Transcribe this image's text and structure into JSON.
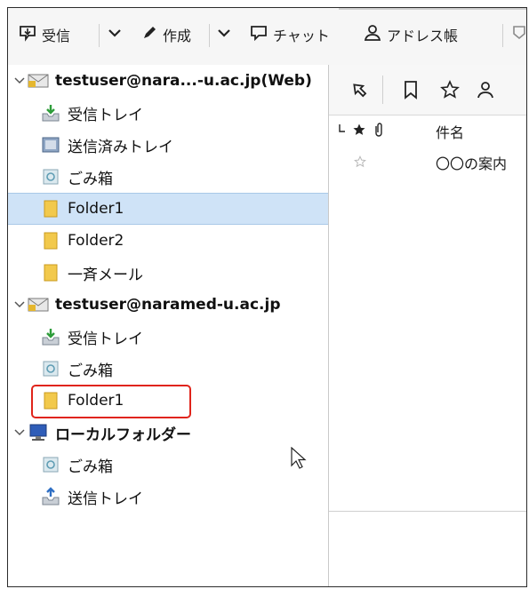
{
  "toolbar": {
    "get_messages_label": "受信",
    "write_label": "作成",
    "chat_label": "チャット",
    "address_book_label": "アドレス帳"
  },
  "folder_pane": {
    "account1": {
      "name": "testuser@nara...-u.ac.jp(Web)",
      "folders": [
        {
          "label": "受信トレイ",
          "icon": "inbox-icon"
        },
        {
          "label": "送信済みトレイ",
          "icon": "sent-icon"
        },
        {
          "label": "ごみ箱",
          "icon": "trash-icon"
        },
        {
          "label": "Folder1",
          "icon": "folder-icon",
          "selected": true
        },
        {
          "label": "Folder2",
          "icon": "folder-icon"
        },
        {
          "label": "一斉メール",
          "icon": "folder-icon"
        }
      ]
    },
    "account2": {
      "name": "testuser@naramed-u.ac.jp",
      "folders": [
        {
          "label": "受信トレイ",
          "icon": "inbox-icon"
        },
        {
          "label": "ごみ箱",
          "icon": "trash-icon"
        },
        {
          "label": "Folder1",
          "icon": "folder-icon",
          "highlighted": true
        }
      ]
    },
    "local_folders": {
      "name": "ローカルフォルダー",
      "folders": [
        {
          "label": "ごみ箱",
          "icon": "trash-icon"
        },
        {
          "label": "送信トレイ",
          "icon": "outbox-icon"
        }
      ]
    }
  },
  "message_list": {
    "columns": {
      "subject": "件名"
    },
    "rows": [
      {
        "subject": "〇〇の案内"
      }
    ]
  },
  "colors": {
    "selection": "#cfe3f7",
    "highlight_box": "#e0241b",
    "folder_yellow": "#f2c94c"
  }
}
